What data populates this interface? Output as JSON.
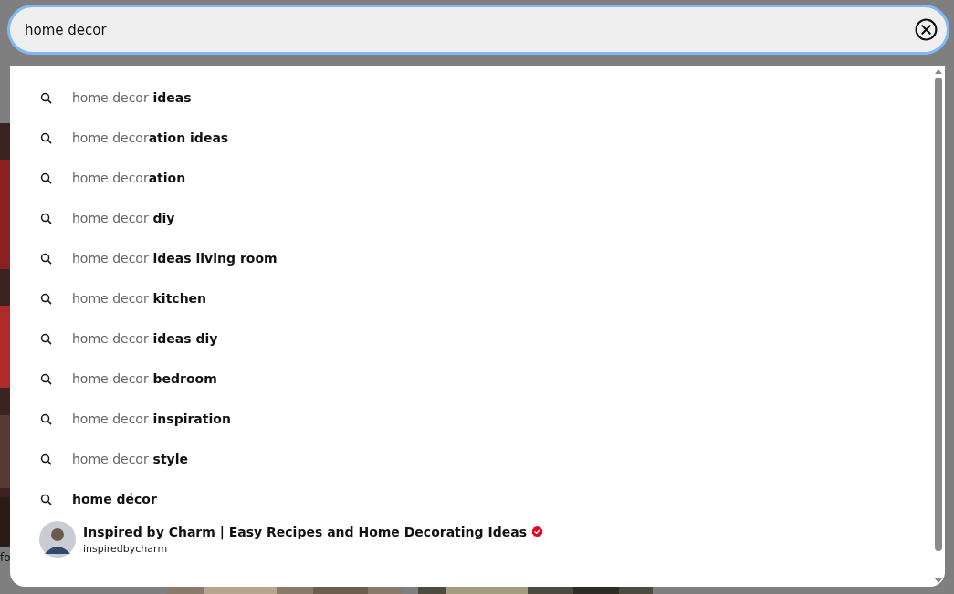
{
  "search": {
    "value": "home decor"
  },
  "suggestions": [
    {
      "prefix": "home decor",
      "suffix": " ideas"
    },
    {
      "prefix": "home decor",
      "suffix": "ation ideas"
    },
    {
      "prefix": "home decor",
      "suffix": "ation"
    },
    {
      "prefix": "home decor",
      "suffix": " diy"
    },
    {
      "prefix": "home decor",
      "suffix": " ideas living room"
    },
    {
      "prefix": "home decor",
      "suffix": " kitchen"
    },
    {
      "prefix": "home decor",
      "suffix": " ideas diy"
    },
    {
      "prefix": "home decor",
      "suffix": " bedroom"
    },
    {
      "prefix": "home decor",
      "suffix": " inspiration"
    },
    {
      "prefix": "home decor",
      "suffix": " style"
    },
    {
      "suffix": "home décor"
    }
  ],
  "profile": {
    "name": "Inspired by Charm | Easy Recipes and Home Decorating Ideas",
    "handle": "inspiredbycharm",
    "verified": true
  },
  "background": {
    "left_text": "fo"
  }
}
